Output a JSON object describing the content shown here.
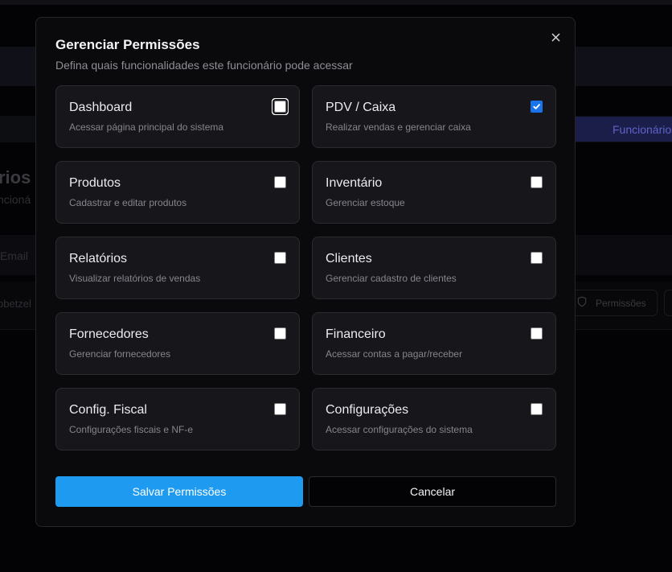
{
  "background": {
    "active_tab_label": "Funcionários",
    "page_title_fragment": "rios",
    "page_subtitle_fragment": "ncioná",
    "table_column_email": "Email",
    "table_cell_fragment": "obetzel",
    "permissions_button_label": "Permissões"
  },
  "modal": {
    "title": "Gerenciar Permissões",
    "description": "Defina quais funcionalidades este funcionário pode acessar",
    "close_icon": "close-icon",
    "permissions": [
      {
        "name": "Dashboard",
        "description": "Acessar página principal do sistema",
        "checked": false,
        "focused": true
      },
      {
        "name": "PDV / Caixa",
        "description": "Realizar vendas e gerenciar caixa",
        "checked": true,
        "focused": false
      },
      {
        "name": "Produtos",
        "description": "Cadastrar e editar produtos",
        "checked": false,
        "focused": false
      },
      {
        "name": "Inventário",
        "description": "Gerenciar estoque",
        "checked": false,
        "focused": false
      },
      {
        "name": "Relatórios",
        "description": "Visualizar relatórios de vendas",
        "checked": false,
        "focused": false
      },
      {
        "name": "Clientes",
        "description": "Gerenciar cadastro de clientes",
        "checked": false,
        "focused": false
      },
      {
        "name": "Fornecedores",
        "description": "Gerenciar fornecedores",
        "checked": false,
        "focused": false
      },
      {
        "name": "Financeiro",
        "description": "Acessar contas a pagar/receber",
        "checked": false,
        "focused": false
      },
      {
        "name": "Config. Fiscal",
        "description": "Configurações fiscais e NF-e",
        "checked": false,
        "focused": false
      },
      {
        "name": "Configurações",
        "description": "Acessar configurações do sistema",
        "checked": false,
        "focused": false
      }
    ],
    "save_label": "Salvar Permissões",
    "cancel_label": "Cancelar"
  },
  "colors": {
    "accent": "#1e9bf0",
    "checkbox_checked": "#1a73e8",
    "modal_bg": "#0a0a0c",
    "card_bg": "#17171b"
  }
}
